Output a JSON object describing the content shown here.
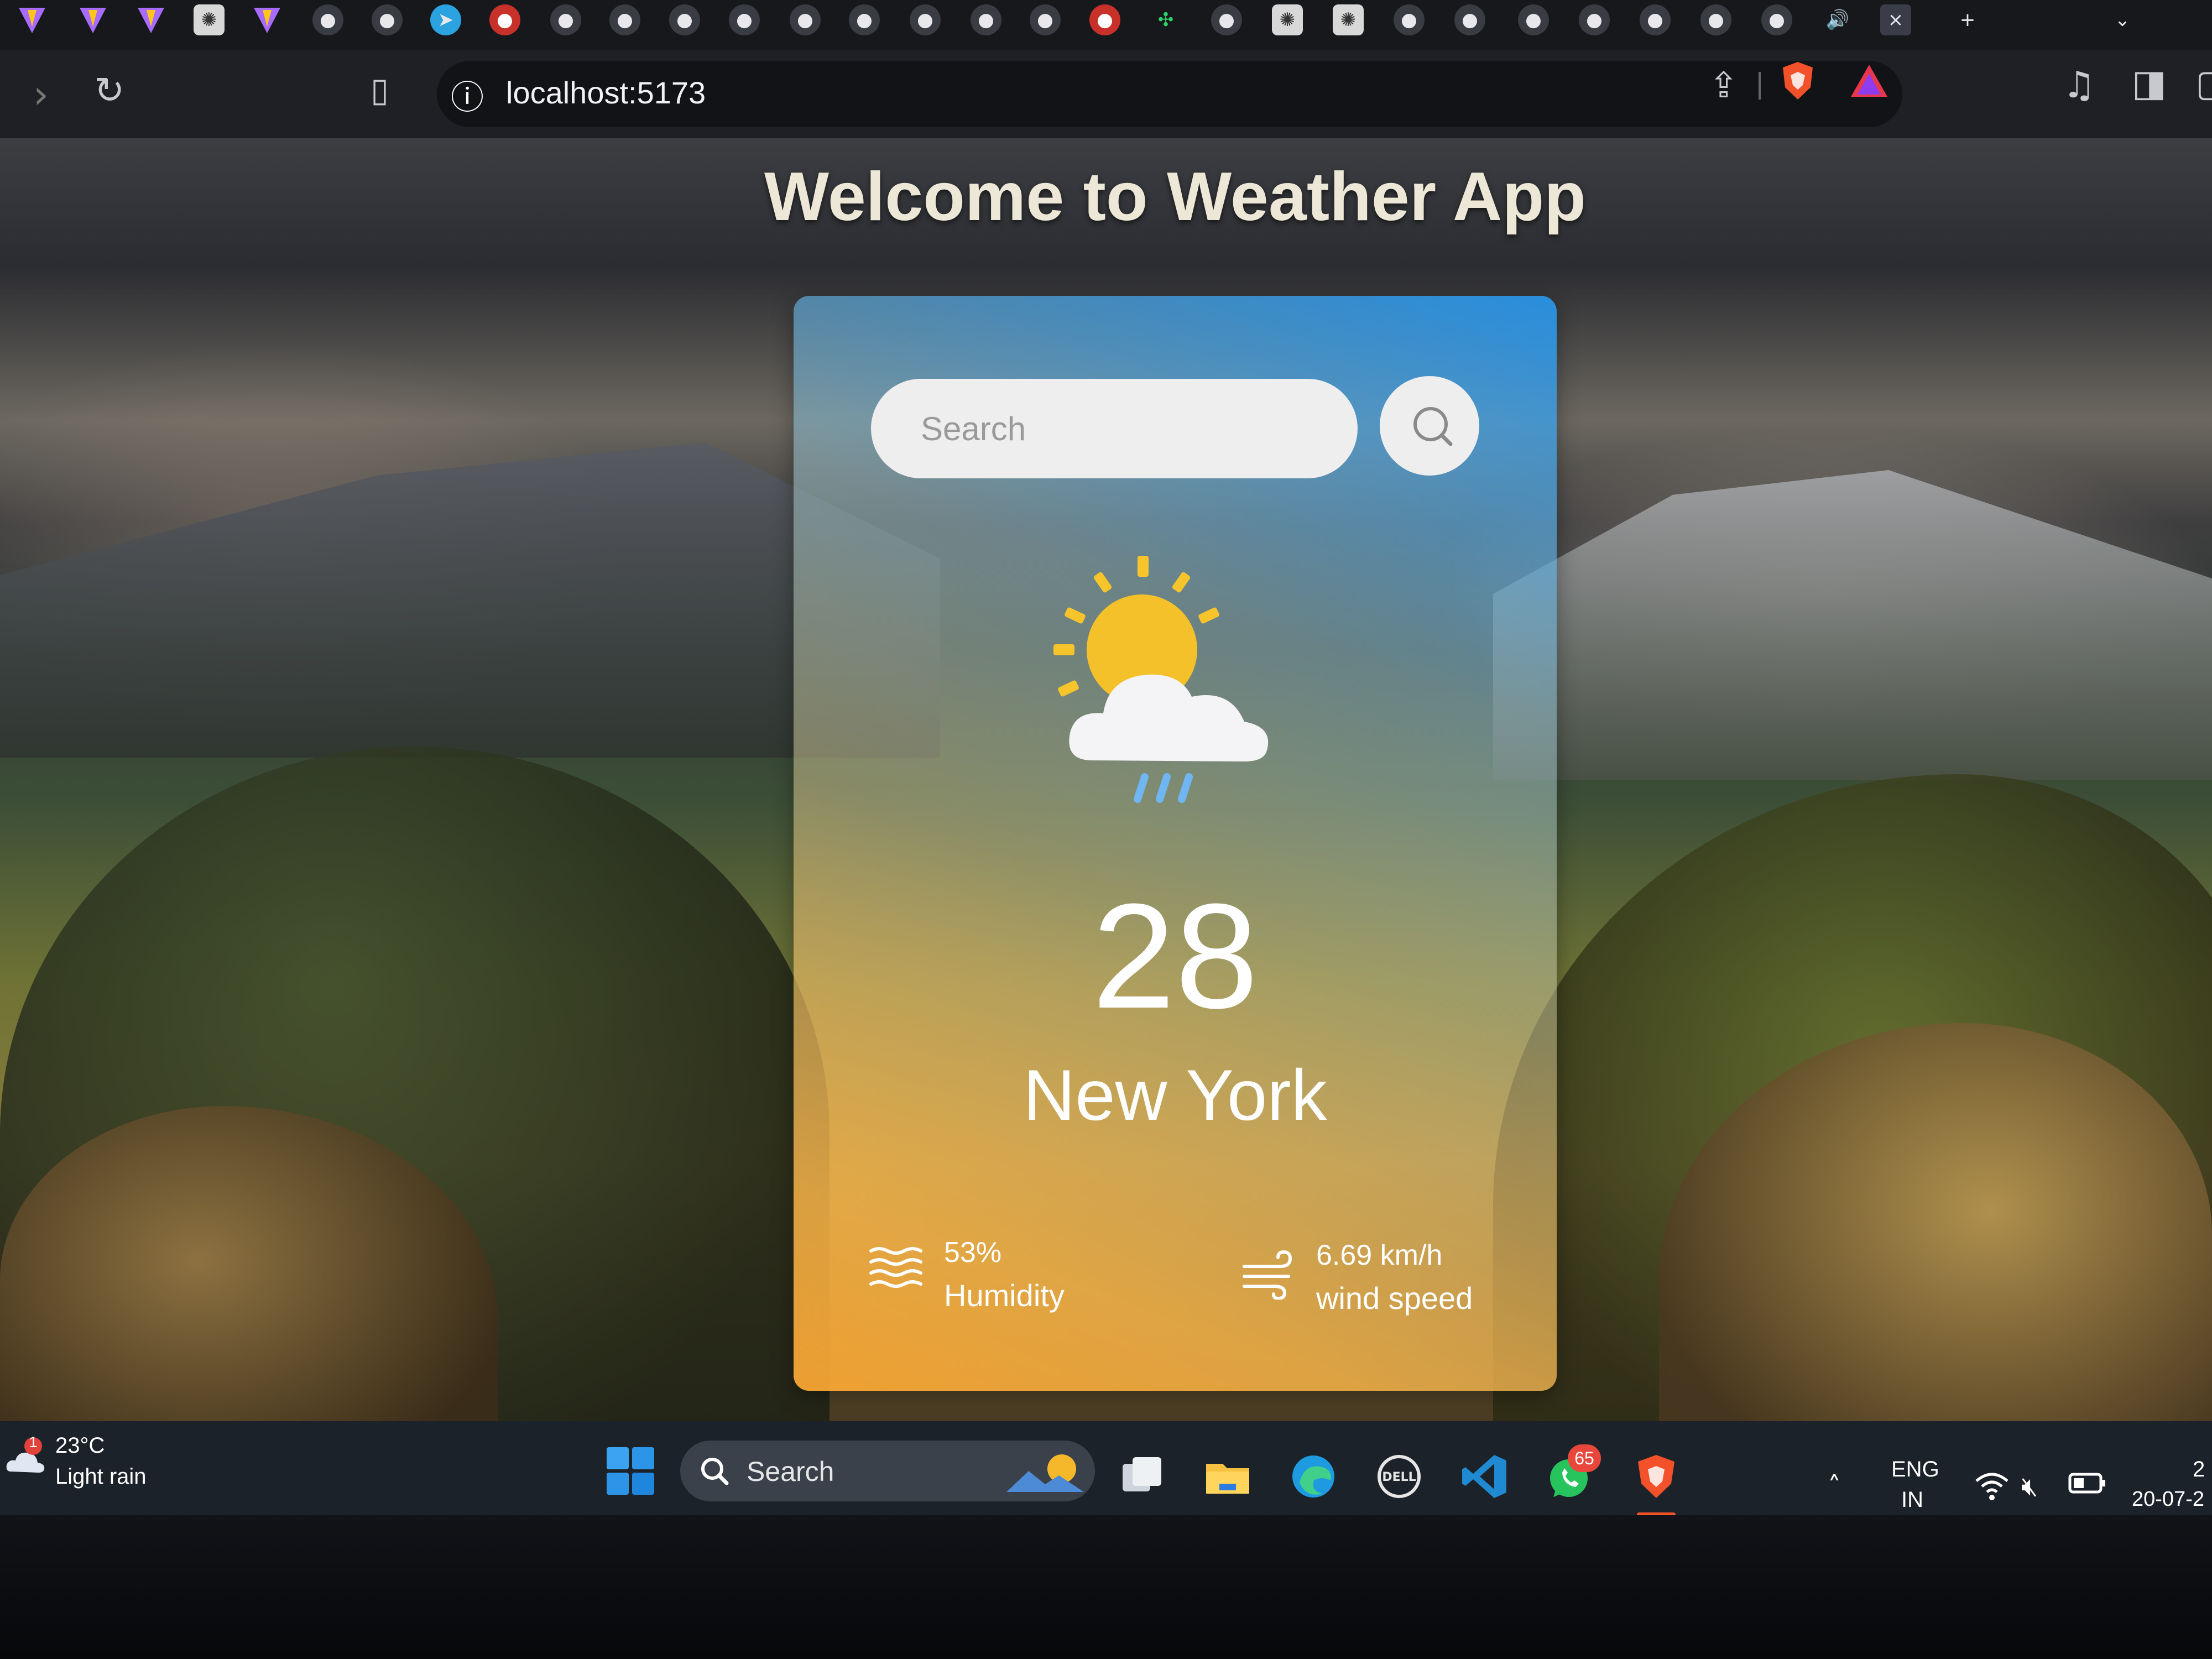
{
  "browser": {
    "tab_strip": {
      "favicons": [
        "vite-icon",
        "vite-icon",
        "vite-icon",
        "openai-icon",
        "vite-icon",
        "github-icon",
        "github-icon",
        "telegram-icon",
        "record-icon",
        "github-icon",
        "github-icon",
        "github-icon",
        "github-icon",
        "github-icon",
        "github-icon",
        "github-icon",
        "github-icon",
        "github-icon",
        "record-icon",
        "clover-icon",
        "github-icon",
        "openai-icon",
        "openai-icon",
        "github-icon",
        "github-icon",
        "github-icon",
        "github-icon",
        "github-icon",
        "github-icon",
        "github-icon"
      ],
      "active_tab_close": "×",
      "new_tab": "+"
    },
    "address_bar": {
      "url": "localhost:5173",
      "info_icon": "ⓘ"
    }
  },
  "page": {
    "title": "Welcome to Weather App",
    "search": {
      "placeholder": "Search",
      "value": ""
    },
    "weather": {
      "icon": "sun-cloud-rain-icon",
      "temperature": "28",
      "city": "New York",
      "humidity": {
        "value": "53%",
        "label": "Humidity"
      },
      "wind": {
        "value": "6.69 km/h",
        "label": "wind speed"
      }
    }
  },
  "taskbar": {
    "weather_widget": {
      "temperature": "23°C",
      "condition": "Light rain",
      "badge": "1"
    },
    "search_label": "Search",
    "whatsapp_badge": "65",
    "tray": {
      "lang_top": "ENG",
      "lang_bottom": "IN",
      "date": "20-07-2",
      "time": "2"
    }
  },
  "colors": {
    "card_top": "#2896eb",
    "card_bottom": "#f8a532",
    "taskbar": "#1c2229",
    "browser_chrome": "#1f2026"
  }
}
